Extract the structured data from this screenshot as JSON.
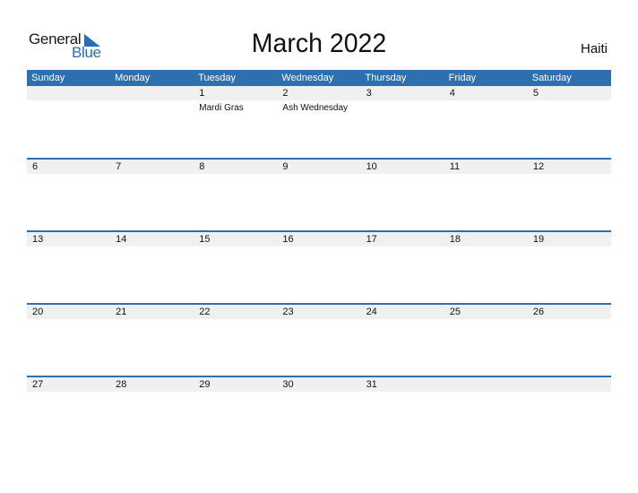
{
  "logo": {
    "line1": "General",
    "line2": "Blue"
  },
  "title": "March 2022",
  "country": "Haiti",
  "weekdays": [
    "Sunday",
    "Monday",
    "Tuesday",
    "Wednesday",
    "Thursday",
    "Friday",
    "Saturday"
  ],
  "weeks": [
    [
      {
        "d": ""
      },
      {
        "d": ""
      },
      {
        "d": "1",
        "h": "Mardi Gras"
      },
      {
        "d": "2",
        "h": "Ash Wednesday"
      },
      {
        "d": "3"
      },
      {
        "d": "4"
      },
      {
        "d": "5"
      }
    ],
    [
      {
        "d": "6"
      },
      {
        "d": "7"
      },
      {
        "d": "8"
      },
      {
        "d": "9"
      },
      {
        "d": "10"
      },
      {
        "d": "11"
      },
      {
        "d": "12"
      }
    ],
    [
      {
        "d": "13"
      },
      {
        "d": "14"
      },
      {
        "d": "15"
      },
      {
        "d": "16"
      },
      {
        "d": "17"
      },
      {
        "d": "18"
      },
      {
        "d": "19"
      }
    ],
    [
      {
        "d": "20"
      },
      {
        "d": "21"
      },
      {
        "d": "22"
      },
      {
        "d": "23"
      },
      {
        "d": "24"
      },
      {
        "d": "25"
      },
      {
        "d": "26"
      }
    ],
    [
      {
        "d": "27"
      },
      {
        "d": "28"
      },
      {
        "d": "29"
      },
      {
        "d": "30"
      },
      {
        "d": "31"
      },
      {
        "d": ""
      },
      {
        "d": ""
      }
    ]
  ],
  "colors": {
    "accent": "#2e6fb0",
    "band": "#f0f0f0"
  }
}
